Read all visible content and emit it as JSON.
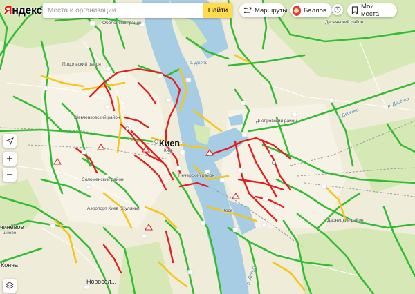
{
  "header": {
    "logo_first": "Я",
    "logo_rest": "ндекс",
    "search_placeholder": "Места и организации",
    "search_button": "Найти",
    "routes_label": "Маршруты",
    "traffic_label": "Баллов",
    "places_label": "Мои места"
  },
  "map": {
    "labels": {
      "obolonsky": "Оболонский район",
      "podolsky": "Подольский район",
      "shevchenkovsky": "Шевченковский район",
      "solomensky": "Соломенский район",
      "pechersky": "Печерский район",
      "dneprovsky": "Днепровский район",
      "desnyansky": "Деснянский район",
      "darnitsky": "Дарницкий район",
      "kyiv": "Киев",
      "kyiv_sub": "Київ",
      "dnepr": "р. Днепр",
      "desenka": "р. Десенка",
      "zhuliany": "Аэропорт Киев (Жуляны)",
      "kosa": "Коса",
      "novosel": "Новосел...",
      "chinevoe": "чинёвое",
      "shneve": "шневе",
      "koncha": "Конча",
      "dnipro_sub": "р. Дніпро",
      "desenka_sub": "р. Десёнка"
    },
    "colors": {
      "free": "#33bb33",
      "slow": "#f5c518",
      "jam": "#e02020",
      "water": "#a6cde3",
      "land": "#efecd9",
      "park": "#d6e8b6"
    }
  }
}
